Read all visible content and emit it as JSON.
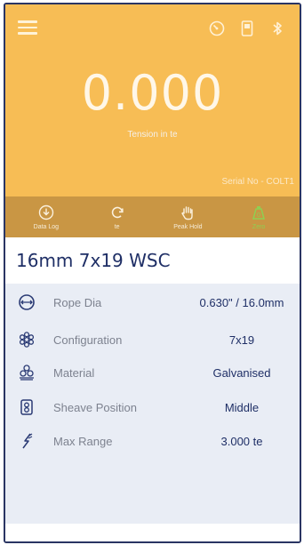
{
  "header": {
    "reading": "0.000",
    "units": "Tension in te",
    "serial": "Serial No - COLT1",
    "icons": [
      "menu-icon",
      "gauge-icon",
      "device-icon",
      "bluetooth-icon"
    ]
  },
  "toolbar": {
    "items": [
      {
        "label": "Data Log",
        "icon": "download-circle-icon"
      },
      {
        "label": "te",
        "icon": "refresh-icon"
      },
      {
        "label": "Peak Hold",
        "icon": "hand-icon"
      },
      {
        "label": "Zero",
        "icon": "zero-icon"
      }
    ]
  },
  "title": "16mm 7x19 WSC",
  "details": [
    {
      "label": "Rope Dia",
      "value": "0.630\" / 16.0mm",
      "icon": "diameter-icon"
    },
    {
      "label": "Configuration",
      "value": "7x19",
      "icon": "strands-icon"
    },
    {
      "label": "Material",
      "value": "Galvanised",
      "icon": "material-icon"
    },
    {
      "label": "Sheave Position",
      "value": "Middle",
      "icon": "sheave-icon"
    },
    {
      "label": "Max Range",
      "value": "3.000 te",
      "icon": "range-icon"
    }
  ],
  "colors": {
    "header": "#f7bd55",
    "toolbar": "#c99644",
    "accent": "#1f2f66",
    "zero": "#8fcf52"
  }
}
